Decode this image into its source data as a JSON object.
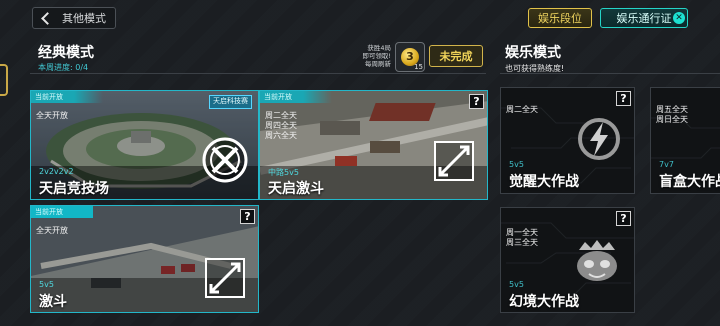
{
  "top_bar": {
    "back_label": "其他模式",
    "rank_label": "娱乐段位",
    "pass_label": "娱乐通行证"
  },
  "classic": {
    "title": "经典模式",
    "progress": "本周进度: 0/4",
    "reward_text_1": "获胜4局",
    "reward_text_2": "即可领取!",
    "reward_text_3": "每周刷新",
    "coin_count": "15",
    "status_label": "未完成"
  },
  "entertainment": {
    "title": "娱乐模式",
    "subtitle": "也可获得熟练度!"
  },
  "cards": {
    "tianqi_arena": {
      "tag": "当前开放",
      "schedule": "全天开放",
      "sub": "2v2v2v2",
      "name": "天启竞技场",
      "badge": "天启科技赛"
    },
    "tianqi_brawl": {
      "tag": "当前开放",
      "schedule_1": "周二全天",
      "schedule_2": "周四全天",
      "schedule_3": "周六全天",
      "sub": "中路5v5",
      "name": "天启激斗"
    },
    "brawl": {
      "tag": "当前开放",
      "schedule": "全天开放",
      "sub": "5v5",
      "name": "激斗"
    },
    "awaken": {
      "schedule": "周二全天",
      "sub": "5v5",
      "name": "觉醒大作战"
    },
    "blindbox": {
      "schedule_1": "周五全天",
      "schedule_2": "周日全天",
      "sub": "7v7",
      "name": "盲盒大作战"
    },
    "dreamland": {
      "schedule_1": "周一全天",
      "schedule_2": "周三全天",
      "sub": "5v5",
      "name": "幻境大作战"
    },
    "help_label": "?"
  },
  "colors": {
    "accent_cyan": "#1aa7b4",
    "gold": "#e1c24a",
    "bg": "#1c1f23"
  },
  "icons": [
    "back-chevron-icon",
    "coin-icon",
    "crossed-swords-icon",
    "expand-arrows-icon",
    "lightning-icon",
    "monster-head-icon",
    "help-icon"
  ]
}
